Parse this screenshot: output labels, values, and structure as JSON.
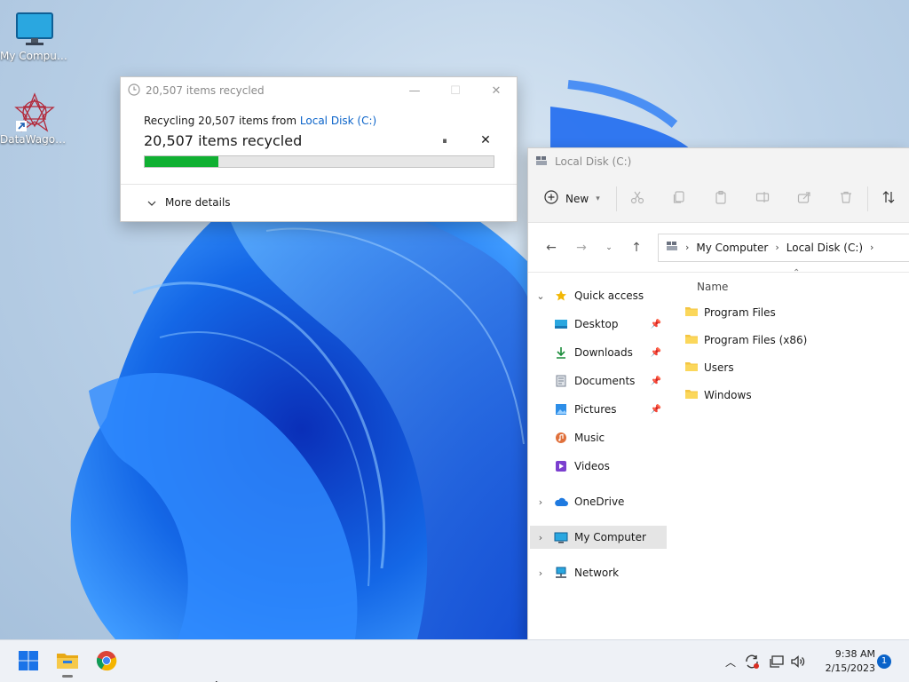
{
  "desktop": {
    "icons": [
      {
        "label": "My Computer"
      },
      {
        "label": "DataWagon..."
      }
    ]
  },
  "progress_dialog": {
    "title": "20,507 items recycled",
    "from_prefix": "Recycling 20,507 items from ",
    "from_location": "Local Disk (C:)",
    "status": "20,507 items recycled",
    "progress_percent": 21,
    "pause_glyph": "⏸",
    "cancel_glyph": "✕",
    "more_details": "More details",
    "colors": {
      "progress": "#10b032",
      "link": "#0a63c9"
    }
  },
  "explorer": {
    "title": "Local Disk (C:)",
    "toolbar": {
      "new_label": "New"
    },
    "address": {
      "crumbs": [
        "My Computer",
        "Local Disk (C:)"
      ]
    },
    "nav": {
      "quick_access": "Quick access",
      "items": [
        {
          "label": "Desktop",
          "icon": "desktop-icon"
        },
        {
          "label": "Downloads",
          "icon": "download-icon"
        },
        {
          "label": "Documents",
          "icon": "documents-icon"
        },
        {
          "label": "Pictures",
          "icon": "pictures-icon"
        },
        {
          "label": "Music",
          "icon": "music-icon"
        },
        {
          "label": "Videos",
          "icon": "videos-icon"
        }
      ],
      "onedrive": "OneDrive",
      "my_computer": "My Computer",
      "network": "Network"
    },
    "content": {
      "column_name": "Name",
      "files": [
        "Program Files",
        "Program Files (x86)",
        "Users",
        "Windows"
      ]
    }
  },
  "taskbar": {
    "time": "9:38 AM",
    "date": "2/15/2023",
    "notification_count": "1"
  }
}
